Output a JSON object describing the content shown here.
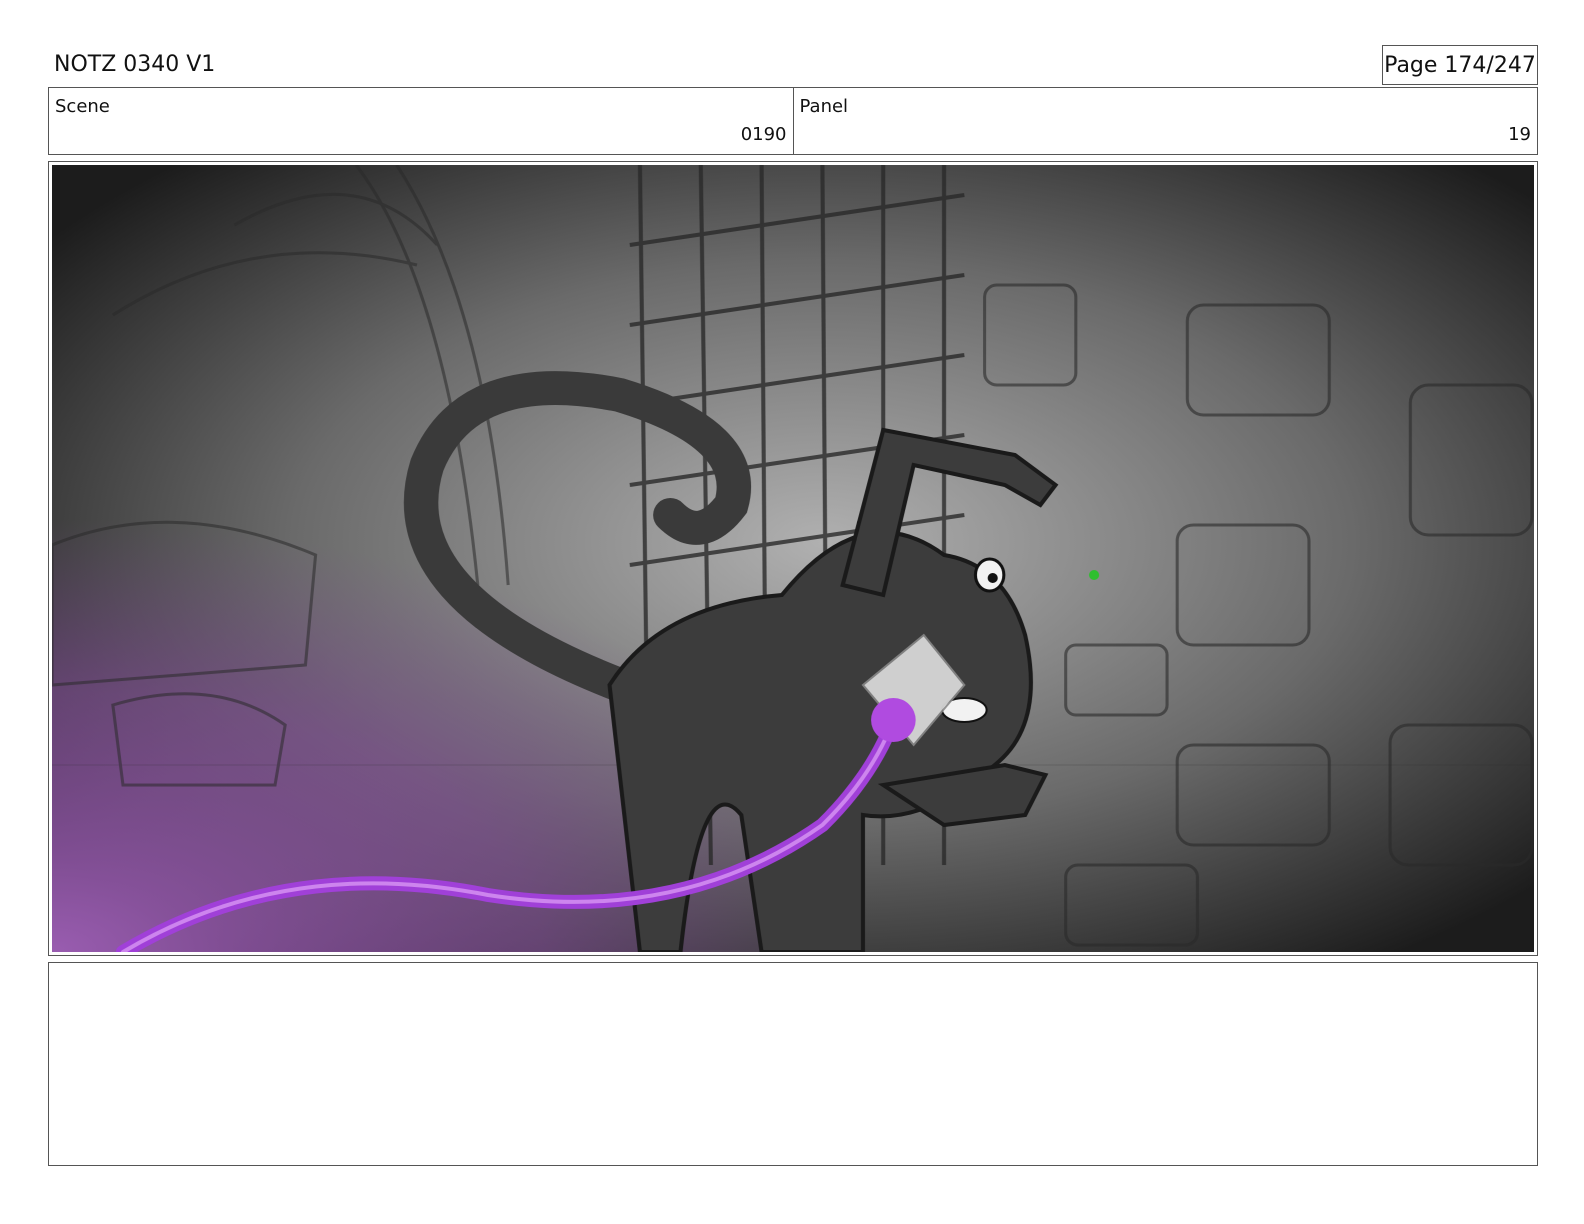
{
  "header": {
    "title": "NOTZ 0340 V1",
    "page": "Page 174/247"
  },
  "scene": {
    "label": "Scene",
    "value": "0190"
  },
  "panel": {
    "label": "Panel",
    "value": "19"
  },
  "artwork": {
    "description_icon": "storyboard-sketch",
    "colors": {
      "dark": "#1c1c1c",
      "light": "#a8a8a8",
      "creature": "#3c3c3c",
      "beam": "#b04be0",
      "eye_light": "#2fbf2f"
    }
  },
  "notes": {
    "text": ""
  }
}
